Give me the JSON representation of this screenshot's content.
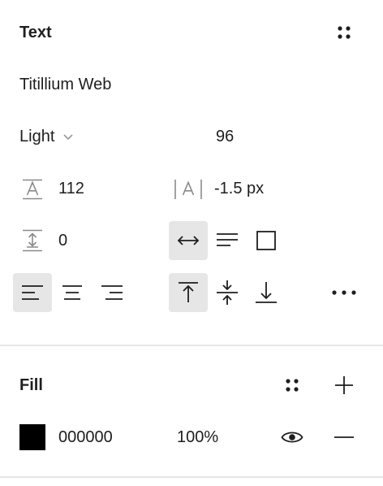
{
  "text_section": {
    "title": "Text",
    "font_family": "Titillium Web",
    "font_weight": "Light",
    "font_size": "96",
    "line_height": "112",
    "letter_spacing": "-1.5 px",
    "paragraph_spacing": "0",
    "resizing": {
      "selected": "auto-width",
      "options": [
        "auto-width",
        "auto-height",
        "fixed-size"
      ]
    },
    "horizontal_align": {
      "selected": "left",
      "options": [
        "left",
        "center",
        "right"
      ]
    },
    "vertical_align": {
      "selected": "top",
      "options": [
        "top",
        "middle",
        "bottom"
      ]
    }
  },
  "fill_section": {
    "title": "Fill",
    "fills": [
      {
        "color": "#000000",
        "hex": "000000",
        "opacity": "100%",
        "visible": true
      }
    ]
  }
}
